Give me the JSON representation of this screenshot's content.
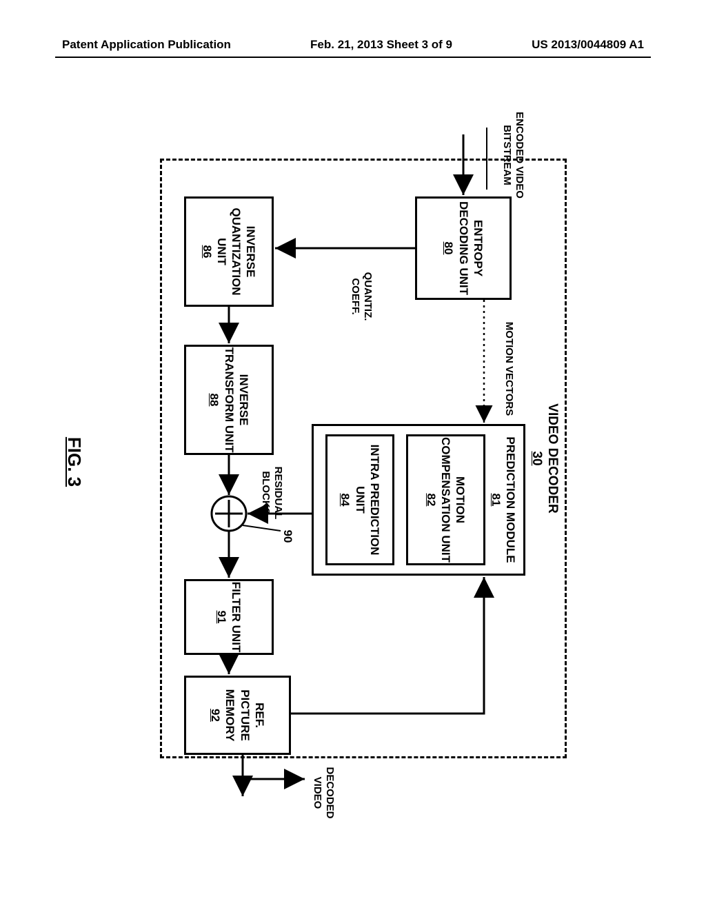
{
  "header": {
    "left": "Patent Application Publication",
    "center": "Feb. 21, 2013  Sheet 3 of 9",
    "right": "US 2013/0044809 A1"
  },
  "diagram": {
    "title": "VIDEO DECODER",
    "title_ref": "30",
    "input_label": "ENCODED VIDEO BITSTREAM",
    "output_label": "DECODED VIDEO",
    "motion_vectors_label": "MOTION VECTORS",
    "quant_coeff_label": "QUANTIZ. COEFF.",
    "residual_label": "RESIDUAL BLOCKS",
    "summer_ref": "90",
    "blocks": {
      "entropy": {
        "label": "ENTROPY DECODING UNIT",
        "ref": "80"
      },
      "invq": {
        "label": "INVERSE QUANTIZATION UNIT",
        "ref": "86"
      },
      "invt": {
        "label": "INVERSE TRANSFORM UNIT",
        "ref": "88"
      },
      "pred": {
        "label": "PREDICTION MODULE",
        "ref": "81"
      },
      "mc": {
        "label": "MOTION COMPENSATION UNIT",
        "ref": "82"
      },
      "intra": {
        "label": "INTRA PREDICTION UNIT",
        "ref": "84"
      },
      "filter": {
        "label": "FILTER UNIT",
        "ref": "91"
      },
      "refmem": {
        "label": "REF. PICTURE MEMORY",
        "ref": "92"
      }
    },
    "figure_caption": "FIG. 3"
  }
}
